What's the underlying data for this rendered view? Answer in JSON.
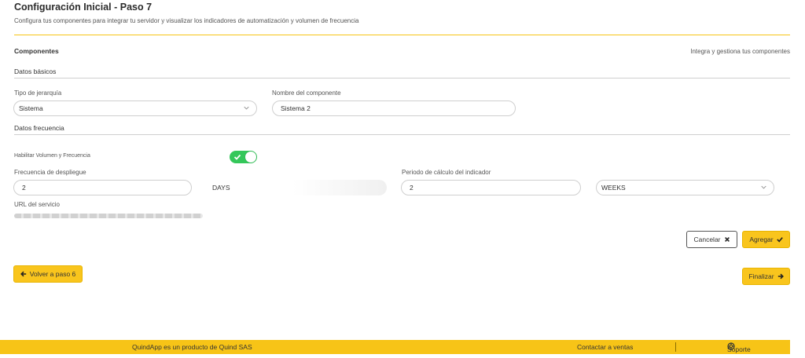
{
  "header": {
    "title": "Configuración Inicial - Paso 7",
    "subtitle": "Configura tus componentes para integrar tu servidor y visualizar los indicadores de automatización y volumen de frecuencia"
  },
  "section": {
    "title": "Componentes",
    "right_text": "Integra y gestiona tus componentes"
  },
  "datos_basicos": {
    "title": "Datos básicos",
    "tipo_label": "Tipo de jerarquía",
    "tipo_value": "Sistema",
    "nombre_label": "Nombre del componente",
    "nombre_value": "Sistema 2"
  },
  "datos_frecuencia": {
    "title": "Datos frecuencia",
    "toggle_label": "Habilitar Volumen y Frecuencia",
    "toggle_on": true,
    "frecuencia_label": "Frecuencia de despliegue",
    "frecuencia_value": "2",
    "frecuencia_unit": "DAYS",
    "periodo_label": "Periodo de cálculo del indicador",
    "periodo_value": "2",
    "periodo_unit": "WEEKS",
    "url_label": "URL del servicio"
  },
  "actions": {
    "cancel_label": "Cancelar",
    "add_label": "Agregar",
    "back_label": "Volver a paso 6",
    "finish_label": "Finalizar"
  },
  "footer": {
    "brand_text": "QuindApp es un producto de Quind SAS",
    "sales_link": "Contactar a ventas",
    "support_link": "Soporte"
  },
  "colors": {
    "accent": "#f7c417",
    "toggle_on": "#34c75a"
  }
}
